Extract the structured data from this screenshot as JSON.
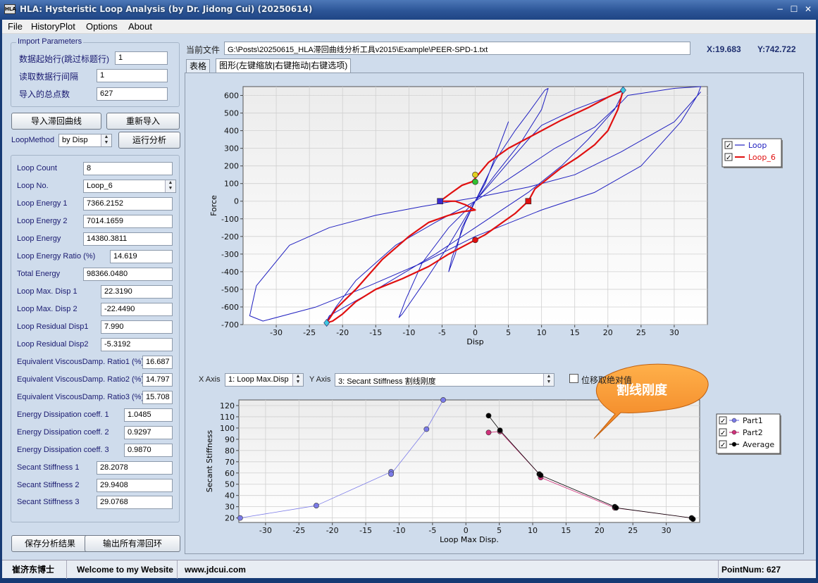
{
  "window": {
    "title": "HLA: Hysteristic Loop Analysis (by Dr. Jidong Cui) (20250614)",
    "icon_text": "HLA",
    "minimize": "−",
    "maximize": "☐",
    "close": "✕"
  },
  "menu": [
    "File",
    "HistoryPlot",
    "Options",
    "About"
  ],
  "import": {
    "legend": "Import Parameters",
    "fields": [
      {
        "label": "数据起始行(跳过标题行)",
        "value": "1"
      },
      {
        "label": "读取数据行间隔",
        "value": "1"
      },
      {
        "label": "导入的总点数",
        "value": "627"
      }
    ]
  },
  "buttons": {
    "import_loop": "导入滞回曲线",
    "reimport": "重新导入",
    "run": "运行分析",
    "save": "保存分析结果",
    "export": "输出所有滞回环"
  },
  "loop_method": {
    "label": "LoopMethod",
    "value": "by Disp"
  },
  "results": [
    {
      "label": "Loop Count",
      "value": "8"
    },
    {
      "label": "Loop No.",
      "value": "Loop_6"
    },
    {
      "label": "Loop Energy 1",
      "value": "7366.2152"
    },
    {
      "label": "Loop Energy 2",
      "value": "7014.1659"
    },
    {
      "label": "Loop Energy",
      "value": "14380.3811"
    },
    {
      "label": "Loop Energy Ratio (%)",
      "value": "14.619"
    },
    {
      "label": "Total Energy",
      "value": "98366.0480"
    },
    {
      "label": "Loop Max. Disp 1",
      "value": "22.3190"
    },
    {
      "label": "Loop Max. Disp 2",
      "value": "-22.4490"
    },
    {
      "label": "Loop Residual Disp1",
      "value": "7.990"
    },
    {
      "label": "Loop Residual Disp2",
      "value": "-5.3192"
    },
    {
      "label": "Equivalent ViscousDamp. Ratio1 (%)",
      "value": "16.687"
    },
    {
      "label": "Equivalent ViscousDamp. Ratio2 (%)",
      "value": "14.797"
    },
    {
      "label": "Equivalent ViscousDamp. Ratio3 (%)",
      "value": "15.708"
    },
    {
      "label": "Energy Dissipation coeff. 1",
      "value": "1.0485"
    },
    {
      "label": "Energy Dissipation coeff. 2",
      "value": "0.9297"
    },
    {
      "label": "Energy Dissipation coeff. 3",
      "value": "0.9870"
    },
    {
      "label": "Secant Stiffness 1",
      "value": "28.2078"
    },
    {
      "label": "Secant Stiffness 2",
      "value": "29.9408"
    },
    {
      "label": "Secant Stiffness 3",
      "value": "29.0768"
    }
  ],
  "file": {
    "label": "当前文件",
    "path": "G:\\Posts\\20250615_HLA滞回曲线分析工具v2015\\Example\\PEER-SPD-1.txt"
  },
  "coords": {
    "x": "X:19.683",
    "y": "Y:742.722"
  },
  "tabs": [
    "表格",
    "图形(左键缩放|右键拖动|右键选项)"
  ],
  "axis_select": {
    "x_label": "X Axis",
    "x_value": "1: Loop Max.Disp",
    "y_label": "Y Axis",
    "y_value": "3: Secant Stiffness 割线刚度",
    "abs_label": "位移取绝对值"
  },
  "callout": "割线刚度",
  "status": {
    "author": "崔济东博士",
    "welcome": "Welcome to my Website",
    "site": "www.jdcui.com",
    "points": "PointNum: 627"
  },
  "colors": {
    "loop": "#2020c0",
    "loop6": "#e01010",
    "part1": "#7b7be8",
    "part2": "#d0307a",
    "average": "#000000",
    "callout": "#ff9933"
  },
  "chart_data": [
    {
      "type": "line",
      "xlabel": "Disp",
      "ylabel": "Force",
      "xlim": [
        -35,
        35
      ],
      "ylim": [
        -700,
        650
      ],
      "xticks": [
        -30,
        -25,
        -20,
        -15,
        -10,
        -5,
        0,
        5,
        10,
        15,
        20,
        25,
        30
      ],
      "yticks": [
        -700,
        -600,
        -500,
        -400,
        -300,
        -200,
        -100,
        0,
        100,
        200,
        300,
        400,
        500,
        600
      ],
      "legend": {
        "placement": "right",
        "entries": [
          "Loop",
          "Loop_6"
        ]
      },
      "series": [
        {
          "name": "Loop",
          "x": [
            0,
            1.5,
            3,
            4.5,
            5,
            4,
            2,
            0,
            -2,
            -3,
            -4,
            -3.5,
            -1.5,
            0,
            3,
            6,
            8,
            10.5,
            11,
            10,
            7,
            3,
            0,
            -4,
            -7.5,
            -11,
            -11.5,
            -10.5,
            -8,
            -4,
            0,
            5,
            8,
            10,
            15,
            22,
            22.5,
            21,
            17,
            13,
            8,
            0,
            -6,
            -14,
            -22,
            -22.5,
            -21,
            -18,
            -12,
            -6,
            0,
            6,
            12,
            18,
            22,
            23,
            30,
            34,
            33.5,
            31,
            25,
            18,
            10,
            0,
            -8,
            -16,
            -24,
            -32,
            -34,
            -33,
            -28,
            -22,
            -15,
            -8,
            0,
            8,
            15,
            22,
            30,
            34
          ],
          "y": [
            0,
            100,
            250,
            400,
            450,
            350,
            150,
            0,
            -150,
            -300,
            -400,
            -320,
            -120,
            0,
            230,
            400,
            500,
            630,
            640,
            520,
            340,
            150,
            0,
            -250,
            -450,
            -640,
            -660,
            -560,
            -350,
            -150,
            0,
            220,
            350,
            430,
            520,
            620,
            630,
            520,
            350,
            200,
            50,
            -150,
            -300,
            -480,
            -650,
            -690,
            -600,
            -450,
            -250,
            -120,
            0,
            150,
            300,
            420,
            560,
            600,
            640,
            650,
            600,
            450,
            200,
            50,
            -50,
            -200,
            -350,
            -480,
            -600,
            -680,
            -650,
            -480,
            -250,
            -150,
            -80,
            -30,
            20,
            80,
            150,
            280,
            450,
            620
          ]
        },
        {
          "name": "Loop_6",
          "x": [
            -5.3,
            -3.5,
            -2,
            -0.5,
            0,
            2,
            5,
            9,
            13,
            17,
            20,
            22.3,
            21.5,
            20,
            18,
            15.5,
            13,
            11,
            9,
            8,
            6,
            4.5,
            3,
            1.5,
            0,
            -2,
            -4,
            -7,
            -11,
            -15,
            -18,
            -20,
            -21.5,
            -22.4,
            -21,
            -18,
            -14,
            -10,
            -7,
            -4,
            -2,
            0,
            -1.5,
            -3,
            -5.3
          ],
          "y": [
            0,
            50,
            90,
            110,
            130,
            220,
            300,
            380,
            460,
            530,
            590,
            630,
            520,
            400,
            320,
            250,
            190,
            130,
            70,
            0,
            -70,
            -110,
            -150,
            -190,
            -220,
            -260,
            -300,
            -370,
            -440,
            -500,
            -570,
            -640,
            -680,
            -690,
            -610,
            -500,
            -330,
            -200,
            -120,
            -80,
            -60,
            -50,
            -20,
            0,
            0
          ]
        }
      ],
      "markers": [
        {
          "shape": "square",
          "x": -5.3,
          "y": 0,
          "color": "#3a2ad0"
        },
        {
          "shape": "square",
          "x": 8,
          "y": 0,
          "color": "#e01010"
        },
        {
          "shape": "circle",
          "x": 0,
          "y": 150,
          "color": "#e0d020"
        },
        {
          "shape": "circle",
          "x": 0,
          "y": 110,
          "color": "#30c030"
        },
        {
          "shape": "circle",
          "x": 0,
          "y": -220,
          "color": "#e01010"
        },
        {
          "shape": "diamond",
          "x": 22.3,
          "y": 630,
          "color": "#40c8e0"
        },
        {
          "shape": "diamond",
          "x": -22.4,
          "y": -690,
          "color": "#40c8e0"
        }
      ]
    },
    {
      "type": "line",
      "xlabel": "Loop Max Disp.",
      "ylabel": "Secant Stiffness",
      "xlim": [
        -34,
        35
      ],
      "ylim": [
        16,
        125
      ],
      "xticks": [
        -30,
        -25,
        -20,
        -15,
        -10,
        -5,
        0,
        5,
        10,
        15,
        20,
        25,
        30
      ],
      "yticks": [
        20,
        30,
        40,
        50,
        60,
        70,
        80,
        90,
        100,
        110,
        120
      ],
      "legend": {
        "placement": "right",
        "entries": [
          "Part1",
          "Part2",
          "Average"
        ]
      },
      "series": [
        {
          "name": "Part1",
          "x": [
            -33.8,
            -22.4,
            -11.2,
            -11.2,
            -5.9,
            -3.4
          ],
          "y": [
            20,
            31,
            61,
            59,
            99,
            125
          ]
        },
        {
          "name": "Part2",
          "x": [
            3.4,
            5.1,
            11,
            11.2,
            22.3,
            33.8
          ],
          "y": [
            96,
            97,
            59,
            56,
            29,
            20
          ]
        },
        {
          "name": "Average",
          "x": [
            3.4,
            5.1,
            11,
            11.2,
            22.3,
            22.5,
            33.8,
            34
          ],
          "y": [
            111,
            98,
            59,
            58,
            30,
            29,
            20,
            19
          ]
        }
      ]
    }
  ]
}
